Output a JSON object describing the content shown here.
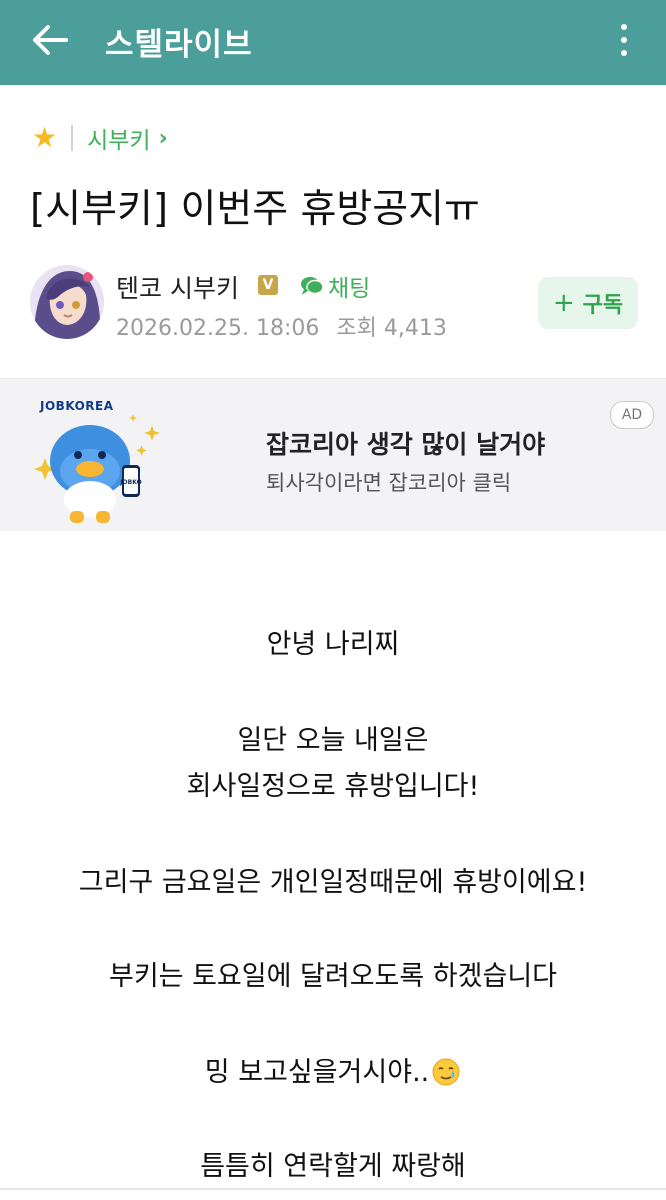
{
  "app_bar": {
    "title": "스텔라이브",
    "back_icon": "arrow-left-icon",
    "more_icon": "more-vertical-icon",
    "color": "#4b9e9a"
  },
  "breadcrumb": {
    "category": "시부키",
    "star_icon": "star-icon"
  },
  "post": {
    "title": "[시부키] 이번주 휴방공지ㅠ",
    "author": "텐코 시부키",
    "badge": "V",
    "chat_label": "채팅",
    "date": "2026.02.25. 18:06",
    "views_label": "조회",
    "views": "4,413",
    "subscribe_label": "구독"
  },
  "ad": {
    "brand": "JOBKOREA",
    "phone_text": "JOBKO",
    "headline": "잡코리아 생각 많이 날거야",
    "subtext": "퇴사각이라면 잡코리아 클릭",
    "tag": "AD"
  },
  "body": {
    "lines": [
      "안녕 나리찌",
      "일단 오늘 내일은",
      "회사일정으로 휴방입니다!",
      "그리구 금요일은 개인일정때문에 휴방이에요!",
      "부키는 토요일에 달려오도록 하겠습니다",
      "밍 보고싶을거시야..",
      "틈틈히 연락할게 짜랑해"
    ],
    "emoji": "smiling-face-with-tear-icon"
  }
}
